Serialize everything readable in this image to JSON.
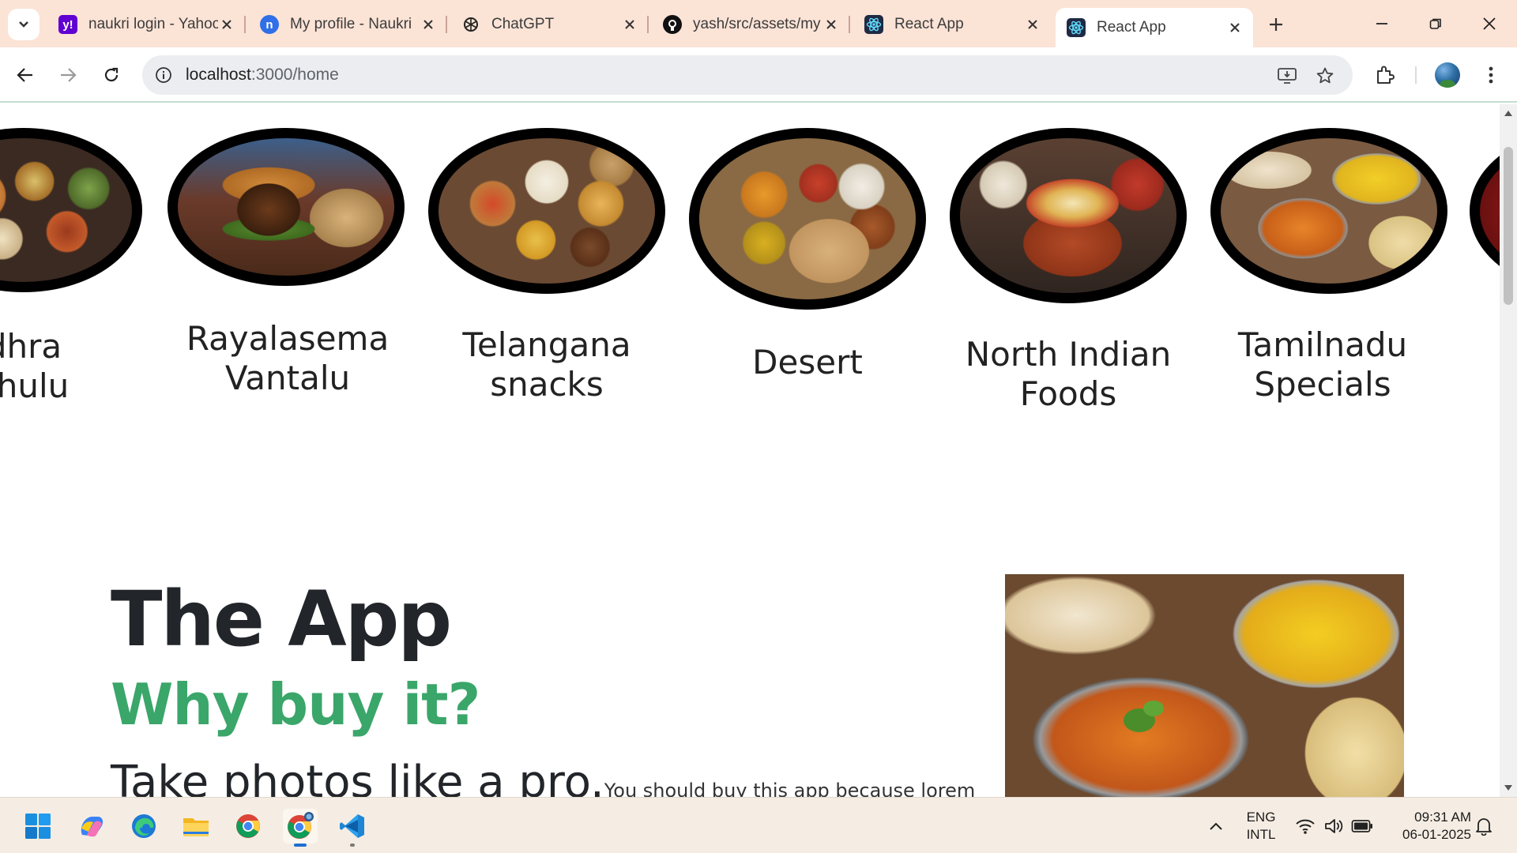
{
  "browser": {
    "tabs": [
      {
        "title": "naukri login - Yahoo",
        "favicon": "yahoo-icon",
        "color": "#6001d2"
      },
      {
        "title": "My profile - Naukri",
        "favicon": "naukri-icon",
        "color": "#2f6fe8"
      },
      {
        "title": "ChatGPT",
        "favicon": "chatgpt-icon",
        "color": "#222222"
      },
      {
        "title": "yash/src/assets/my",
        "favicon": "github-icon",
        "color": "#111111"
      },
      {
        "title": "React App",
        "favicon": "react-icon",
        "color": "#1f2a44"
      },
      {
        "title": "React App",
        "favicon": "react-icon",
        "color": "#1f2a44",
        "active": true
      }
    ],
    "address": {
      "host": "localhost",
      "path": ":3000/home"
    }
  },
  "categories": [
    {
      "name": "Andhra Pachulu",
      "visible_text": "dhra\nchulu",
      "image": "andhra-platter"
    },
    {
      "name": "Rayalasema Vantalu",
      "image": "burger"
    },
    {
      "name": "Telangana snacks",
      "image": "snacks-spread"
    },
    {
      "name": "Desert",
      "image": "thali"
    },
    {
      "name": "North Indian Foods",
      "image": "biryani-pot"
    },
    {
      "name": "Tamilnadu Specials",
      "image": "curry-rice"
    }
  ],
  "about": {
    "title": "The App",
    "subtitle": "Why buy it?",
    "tagline": "Take photos like a pro.",
    "body": "You should buy this app because lorem"
  },
  "colors": {
    "accent_green": "#3aa66a",
    "heading": "#222529",
    "tabstrip": "#fbe3d6",
    "taskbar": "#f5ede3"
  },
  "taskbar": {
    "apps": [
      "windows-start-icon",
      "copilot-icon",
      "edge-icon",
      "file-explorer-icon",
      "chrome-icon",
      "chrome-dev-icon",
      "vscode-icon"
    ],
    "lang_line1": "ENG",
    "lang_line2": "INTL",
    "time": "09:31 AM",
    "date": "06-01-2025"
  }
}
